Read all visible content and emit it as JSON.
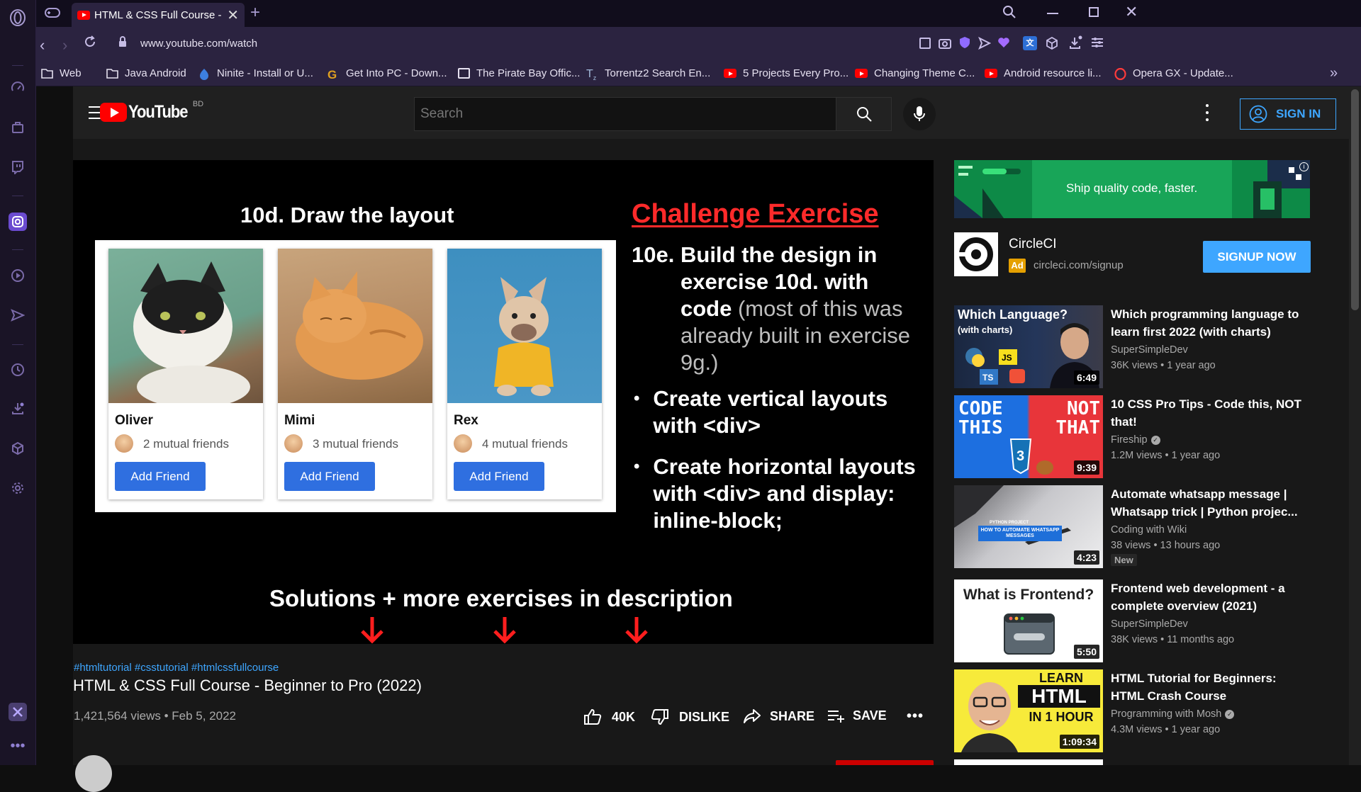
{
  "browser": {
    "tab_title": "HTML & CSS Full Course - B",
    "url": "www.youtube.com/watch",
    "bookmarks": [
      {
        "label": "Web",
        "icon": "folder-icon"
      },
      {
        "label": "Java Android",
        "icon": "folder-icon"
      },
      {
        "label": "Ninite - Install or U...",
        "icon": "ninite-icon"
      },
      {
        "label": "Get Into PC - Down...",
        "icon": "getintopc-icon"
      },
      {
        "label": "The Pirate Bay Offic...",
        "icon": "piratebay-icon"
      },
      {
        "label": "Torrentz2 Search En...",
        "icon": "torrentz-icon"
      },
      {
        "label": "5 Projects Every Pro...",
        "icon": "youtube-icon"
      },
      {
        "label": "Changing Theme C...",
        "icon": "youtube-icon"
      },
      {
        "label": "Android resource li...",
        "icon": "youtube-icon"
      },
      {
        "label": "Opera GX - Update...",
        "icon": "opera-icon"
      }
    ]
  },
  "youtube": {
    "logo_text": "YouTube",
    "country_code": "BD",
    "search_placeholder": "Search",
    "sign_in_label": "SIGN IN"
  },
  "video": {
    "slide": {
      "left_heading": "10d. Draw the layout",
      "right_heading": "Challenge Exercise",
      "task_label": "10e.",
      "task_main": "Build the design in exercise 10d. with code",
      "task_paren": "(most of this was already built in exercise 9g.)",
      "bullet1": "Create vertical layouts with <div>",
      "bullet2": "Create horizontal layouts with <div> and display: inline-block;",
      "footer": "Solutions + more exercises in description",
      "cards": [
        {
          "name": "Oliver",
          "mutual": "2 mutual friends",
          "button": "Add Friend"
        },
        {
          "name": "Mimi",
          "mutual": "3 mutual friends",
          "button": "Add Friend"
        },
        {
          "name": "Rex",
          "mutual": "4 mutual friends",
          "button": "Add Friend"
        }
      ]
    },
    "hashtags": "#htmltutorial #csstutorial #htmlcssfullcourse",
    "title": "HTML & CSS Full Course - Beginner to Pro (2022)",
    "meta": "1,421,564 views • Feb 5, 2022",
    "likes": "40K",
    "dislike_label": "DISLIKE",
    "share_label": "SHARE",
    "save_label": "SAVE"
  },
  "ad": {
    "banner_text": "Ship quality code, faster.",
    "name": "CircleCI",
    "badge": "Ad",
    "url": "circleci.com/signup",
    "cta": "SIGNUP NOW"
  },
  "recommendations": [
    {
      "title": "Which programming language to learn first 2022 (with charts)",
      "channel": "SuperSimpleDev",
      "verified": false,
      "meta": "36K views • 1 year ago",
      "duration": "6:49",
      "thumb_text": "Which Language?",
      "thumb_sub": "(with charts)",
      "new": ""
    },
    {
      "title": "10 CSS Pro Tips - Code this, NOT that!",
      "channel": "Fireship",
      "verified": true,
      "meta": "1.2M views • 1 year ago",
      "duration": "9:39",
      "thumb_text": "CODE THIS",
      "thumb_sub": "NOT THAT",
      "new": ""
    },
    {
      "title": "Automate whatsapp message | Whatsapp trick | Python projec...",
      "channel": "Coding with Wiki",
      "verified": false,
      "meta": "38 views • 13 hours ago",
      "duration": "4:23",
      "thumb_text": "HOW TO AUTOMATE WHATSAPP MESSAGES",
      "thumb_sub": "PYTHON PROJECT",
      "new": "New"
    },
    {
      "title": "Frontend web development - a complete overview (2021)",
      "channel": "SuperSimpleDev",
      "verified": false,
      "meta": "38K views • 11 months ago",
      "duration": "5:50",
      "thumb_text": "What is Frontend?",
      "thumb_sub": "",
      "new": ""
    },
    {
      "title": "HTML Tutorial for Beginners: HTML Crash Course",
      "channel": "Programming with Mosh",
      "verified": true,
      "meta": "4.3M views • 1 year ago",
      "duration": "1:09:34",
      "thumb_text": "HTML",
      "thumb_sub": "LEARN",
      "thumb_sub2": "IN 1 HOUR",
      "new": ""
    }
  ]
}
